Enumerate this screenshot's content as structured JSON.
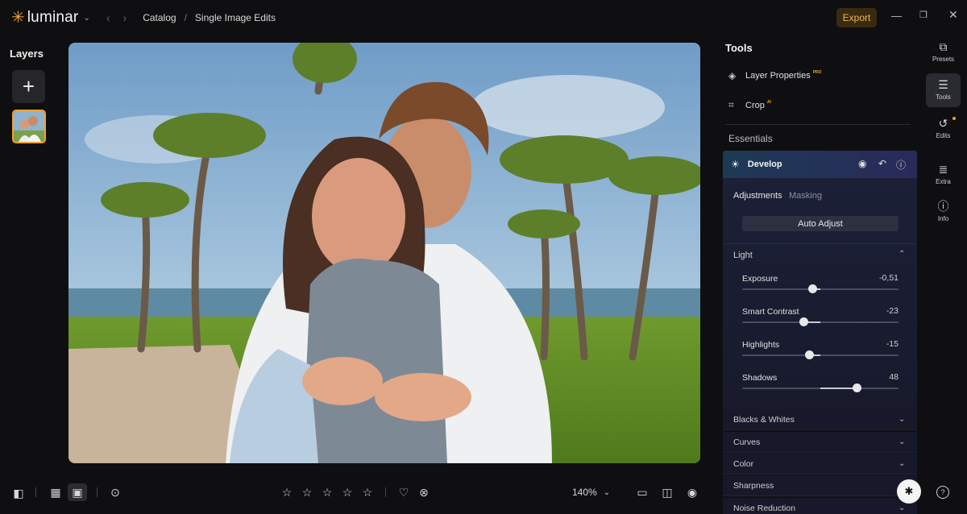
{
  "app": {
    "logo_text": "luminar",
    "breadcrumb": [
      "Catalog",
      "Single Image Edits"
    ],
    "export_label": "Export",
    "accent": "#f2a22d"
  },
  "layers": {
    "title": "Layers",
    "add_icon": "plus-icon"
  },
  "bottombar": {
    "zoom": "140%",
    "rating_stars": 5,
    "rating_value": 0
  },
  "tools": {
    "title": "Tools",
    "layer_properties": {
      "label": "Layer Properties",
      "badge": "PRO"
    },
    "crop": {
      "label": "Crop",
      "badge": "AI"
    },
    "essentials_title": "Essentials",
    "develop": {
      "title": "Develop",
      "tabs": [
        "Adjustments",
        "Masking"
      ],
      "active_tab": "Adjustments",
      "auto_adjust": "Auto Adjust",
      "light_title": "Light",
      "sliders": [
        {
          "label": "Exposure",
          "value": "-0,51",
          "fraction": 0.45
        },
        {
          "label": "Smart Contrast",
          "value": "-23",
          "fraction": 0.39
        },
        {
          "label": "Highlights",
          "value": "-15",
          "fraction": 0.43
        },
        {
          "label": "Shadows",
          "value": "48",
          "fraction": 0.73
        }
      ]
    },
    "sections": [
      "Blacks & Whites",
      "Curves",
      "Color",
      "Sharpness",
      "Noise Reduction"
    ]
  },
  "rail": [
    {
      "label": "Presets",
      "icon": "presets-icon"
    },
    {
      "label": "Tools",
      "icon": "sliders-icon"
    },
    {
      "label": "Edits",
      "icon": "history-icon"
    },
    {
      "label": "Extra",
      "icon": "list-icon"
    },
    {
      "label": "Info",
      "icon": "info-icon"
    }
  ]
}
